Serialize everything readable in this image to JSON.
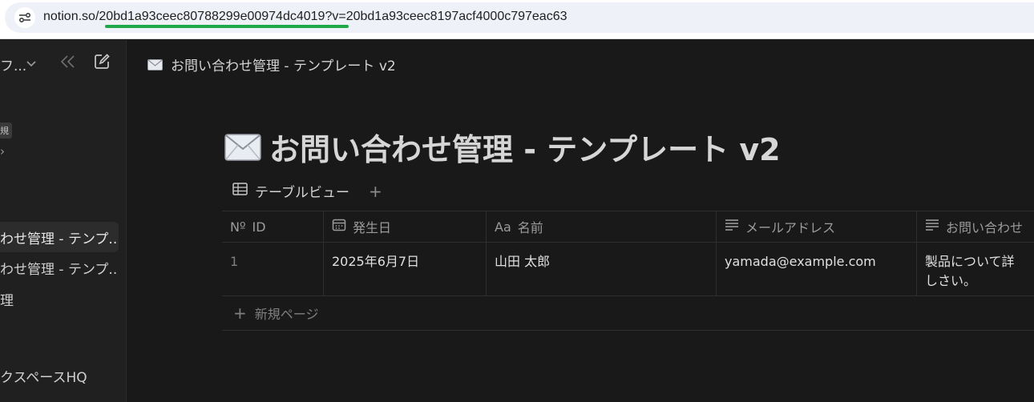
{
  "browser": {
    "url_host": "notion.so/",
    "url_path": "20bd1a93ceec80788299e00974dc4019",
    "url_query": "?v=20bd1a93ceec8197acf4000c797eac63"
  },
  "sidebar": {
    "workspace_name": "フ...",
    "new_badge": "規",
    "arrow_glyph": "›",
    "items": [
      {
        "label": "わせ管理 - テンプ..."
      },
      {
        "label": "わせ管理 - テンプ..."
      },
      {
        "label": "理"
      },
      {
        "label": "クスペースHQ"
      }
    ]
  },
  "topbar": {
    "title": "お問い合わせ管理 - テンプレート v2"
  },
  "page": {
    "title": "お問い合わせ管理 - テンプレート v2",
    "view_tab": "テーブルビュー",
    "add_view": "+"
  },
  "table": {
    "columns": [
      {
        "icon": "Nº",
        "label": "ID"
      },
      {
        "icon": "calendar-icon",
        "label": "発生日"
      },
      {
        "icon": "Aa",
        "label": "名前"
      },
      {
        "icon": "text-lines-icon",
        "label": "メールアドレス"
      },
      {
        "icon": "text-lines-icon",
        "label": "お問い合わせ"
      }
    ],
    "rows": [
      {
        "id": "1",
        "date": "2025年6月7日",
        "name": "山田 太郎",
        "email": "yamada@example.com",
        "inquiry": "製品について詳しさい。"
      }
    ],
    "new_page_label": "新規ページ",
    "new_page_plus": "+"
  }
}
